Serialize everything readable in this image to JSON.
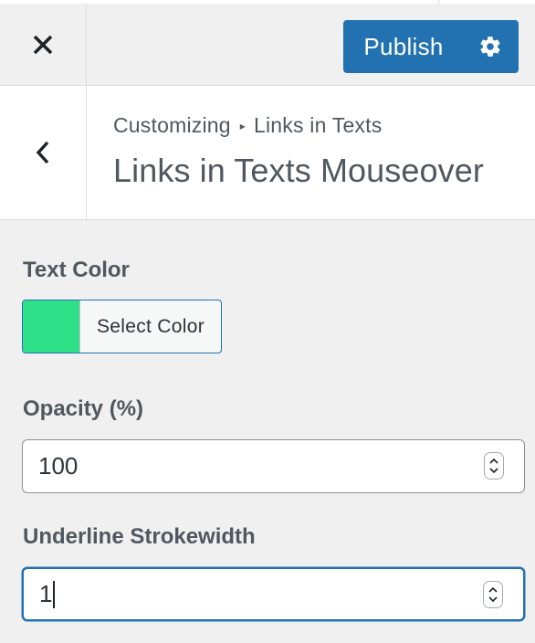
{
  "header": {
    "close_icon": "close-icon",
    "publish_label": "Publish",
    "settings_icon": "gear-icon",
    "accent": "#2271b1"
  },
  "section": {
    "back_icon": "chevron-left-icon",
    "breadcrumb": [
      "Customizing",
      "Links in Texts"
    ],
    "breadcrumb_separator": "▸",
    "title": "Links in Texts Mouseover"
  },
  "controls": {
    "text_color": {
      "label": "Text Color",
      "swatch_color": "#2ee088",
      "button_label": "Select Color"
    },
    "opacity": {
      "label": "Opacity (%)",
      "value": "100"
    },
    "underline": {
      "label": "Underline Strokewidth",
      "value": "1"
    }
  }
}
